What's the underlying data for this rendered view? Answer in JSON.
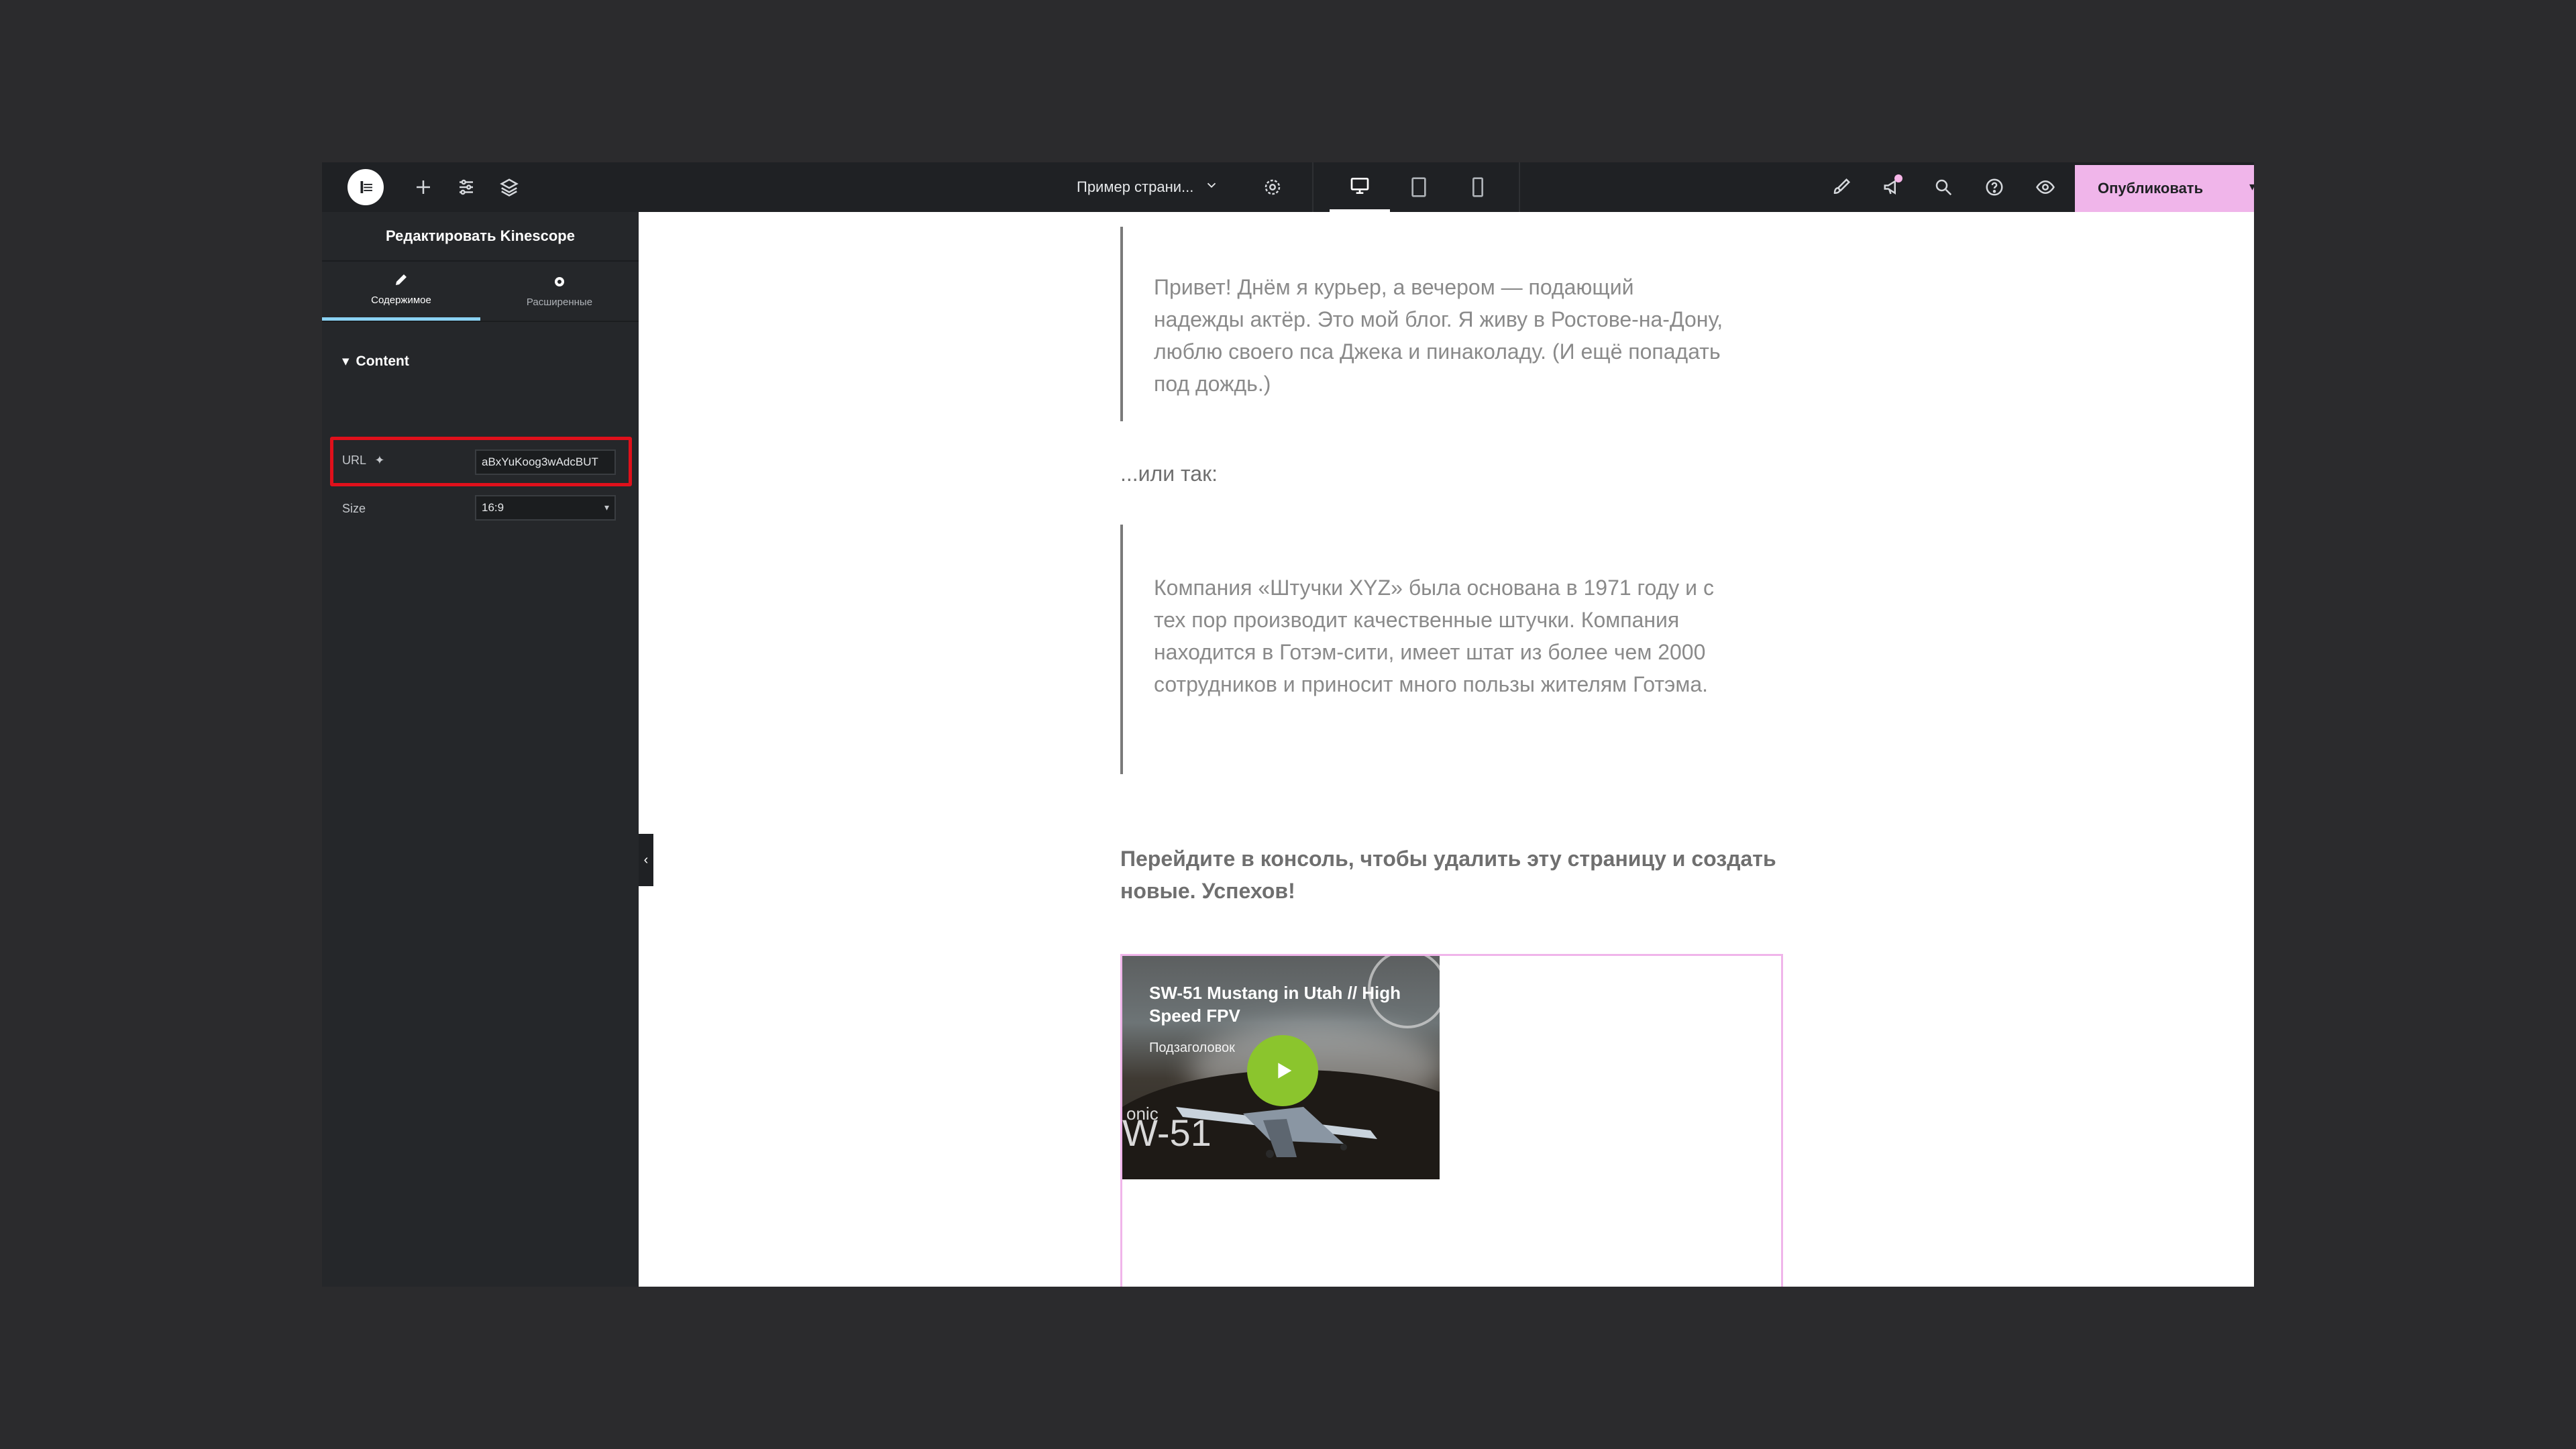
{
  "topbar": {
    "page_name": "Пример страни...",
    "publish_label": "Опубликовать",
    "device_modes": [
      "desktop",
      "tablet",
      "mobile"
    ],
    "active_device": "desktop",
    "icons": [
      "elementor-logo-icon",
      "plus-icon",
      "sliders-icon",
      "layers-icon",
      "chevron-down-icon",
      "gear-icon",
      "desktop-icon",
      "tablet-icon",
      "mobile-icon",
      "brush-icon",
      "megaphone-icon",
      "search-icon",
      "help-icon",
      "eye-icon",
      "caret-down-icon"
    ]
  },
  "panel": {
    "title": "Редактировать Kinescope",
    "tabs": [
      {
        "label": "Содержимое",
        "icon": "pencil-icon",
        "active": true
      },
      {
        "label": "Расширенные",
        "icon": "gear-icon",
        "active": false
      }
    ],
    "section_title": "Content",
    "url": {
      "label": "URL",
      "value": "aBxYuKoog3wAdcBUT"
    },
    "size": {
      "label": "Size",
      "value": "16:9"
    }
  },
  "content": {
    "quote1": "Привет! Днём я курьер, а вечером — подающий надежды актёр. Это мой блог. Я живу в Ростове-на-Дону, люблю своего пса Джека и пинаколаду. (И ещё попадать под дождь.)",
    "ortak": "...или так:",
    "quote2": "Компания «Штучки XYZ» была основана в 1971 году и с тех пор производит качественные штучки. Компания находится в Готэм-сити, имеет штат из более чем 2000 сотрудников и приносит много пользы жителям Готэма.",
    "final": "Перейдите в консоль, чтобы удалить эту страницу и создать новые. Успехов!",
    "video": {
      "title": "SW-51 Mustang in Utah // High Speed FPV",
      "subtitle": "Подзаголовок",
      "watermark_small": "onic",
      "watermark_big": "W-51"
    }
  },
  "colors": {
    "topbar_bg": "#1f2124",
    "panel_bg": "#25272a",
    "publish_bg": "#f0b5ea",
    "highlight": "#e0101b",
    "play_button": "#8bc52d"
  }
}
